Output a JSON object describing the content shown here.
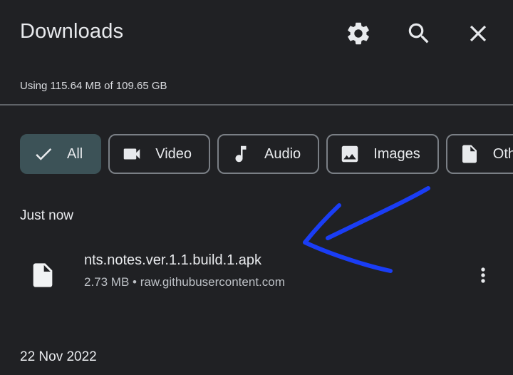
{
  "header": {
    "title": "Downloads",
    "icons": [
      "settings-icon",
      "search-icon",
      "close-icon"
    ]
  },
  "storage": {
    "text": "Using 115.64 MB of 109.65 GB"
  },
  "filters": [
    {
      "label": "All",
      "icon": "check-icon",
      "selected": true
    },
    {
      "label": "Video",
      "icon": "video-icon",
      "selected": false
    },
    {
      "label": "Audio",
      "icon": "music-note-icon",
      "selected": false
    },
    {
      "label": "Images",
      "icon": "image-icon",
      "selected": false
    },
    {
      "label": "Oth",
      "icon": "file-icon",
      "selected": false
    }
  ],
  "sections": [
    {
      "label": "Just now",
      "items": [
        {
          "name": "nts.notes.ver.1.1.build.1.apk",
          "meta": "2.73 MB • raw.githubusercontent.com",
          "icon": "file-icon"
        }
      ]
    },
    {
      "label": "22 Nov 2022",
      "items": []
    }
  ],
  "colors": {
    "background": "#202124",
    "selected_chip": "#3c5257",
    "annotation_arrow": "#1a3df5"
  }
}
